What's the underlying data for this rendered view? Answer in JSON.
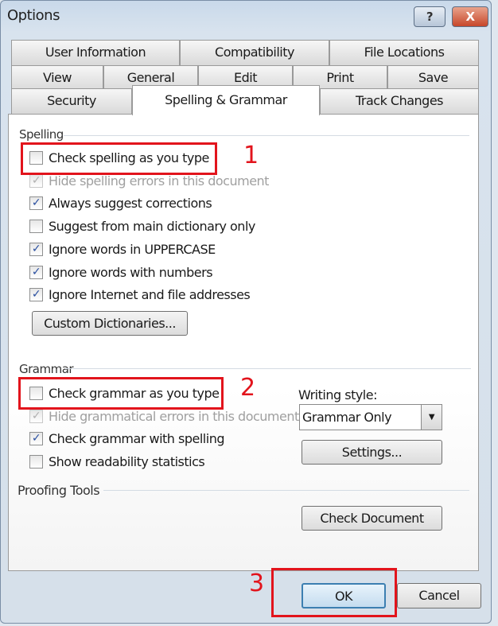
{
  "window": {
    "title": "Options",
    "help": "?",
    "close": "X"
  },
  "tabs": {
    "row1": [
      "User Information",
      "Compatibility",
      "File Locations"
    ],
    "row2": [
      "View",
      "General",
      "Edit",
      "Print",
      "Save"
    ],
    "row3": [
      "Security",
      "Spelling & Grammar",
      "Track Changes"
    ],
    "selected": "Spelling & Grammar"
  },
  "spelling": {
    "label": "Spelling",
    "items": [
      {
        "label": "Check spelling as you type",
        "checked": false,
        "disabled": false
      },
      {
        "label": "Hide spelling errors in this document",
        "checked": true,
        "disabled": true
      },
      {
        "label": "Always suggest corrections",
        "checked": true,
        "disabled": false
      },
      {
        "label": "Suggest from main dictionary only",
        "checked": false,
        "disabled": false
      },
      {
        "label": "Ignore words in UPPERCASE",
        "checked": true,
        "disabled": false
      },
      {
        "label": "Ignore words with numbers",
        "checked": true,
        "disabled": false
      },
      {
        "label": "Ignore Internet and file addresses",
        "checked": true,
        "disabled": false
      }
    ],
    "custom_dict": "Custom Dictionaries..."
  },
  "grammar": {
    "label": "Grammar",
    "items": [
      {
        "label": "Check grammar as you type",
        "checked": false,
        "disabled": false
      },
      {
        "label": "Hide grammatical errors in this document",
        "checked": true,
        "disabled": true
      },
      {
        "label": "Check grammar with spelling",
        "checked": true,
        "disabled": false
      },
      {
        "label": "Show readability statistics",
        "checked": false,
        "disabled": false
      }
    ],
    "writing_style_label": "Writing style:",
    "writing_style": "Grammar Only",
    "settings": "Settings..."
  },
  "proofing": {
    "label": "Proofing Tools",
    "check_document": "Check Document"
  },
  "footer": {
    "ok": "OK",
    "cancel": "Cancel"
  },
  "annotations": [
    "1",
    "2",
    "3"
  ],
  "colors": {
    "annotation": "#e2141c"
  }
}
